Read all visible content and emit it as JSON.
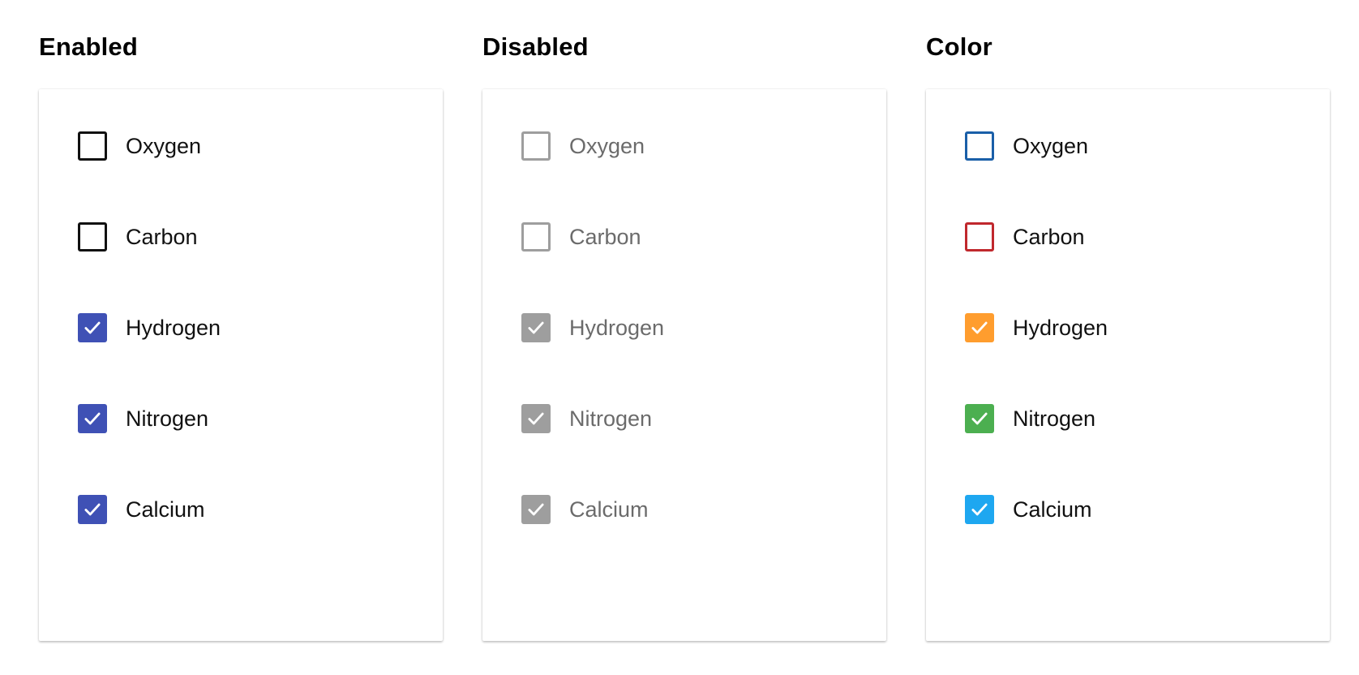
{
  "sections": [
    {
      "title": "Enabled",
      "disabled": false,
      "items": [
        {
          "label": "Oxygen",
          "checked": false,
          "color": "#111111"
        },
        {
          "label": "Carbon",
          "checked": false,
          "color": "#111111"
        },
        {
          "label": "Hydrogen",
          "checked": true,
          "color": "#3f51b5"
        },
        {
          "label": "Nitrogen",
          "checked": true,
          "color": "#3f51b5"
        },
        {
          "label": "Calcium",
          "checked": true,
          "color": "#3f51b5"
        }
      ]
    },
    {
      "title": "Disabled",
      "disabled": true,
      "items": [
        {
          "label": "Oxygen",
          "checked": false,
          "color": "#9e9e9e"
        },
        {
          "label": "Carbon",
          "checked": false,
          "color": "#9e9e9e"
        },
        {
          "label": "Hydrogen",
          "checked": true,
          "color": "#9e9e9e"
        },
        {
          "label": "Nitrogen",
          "checked": true,
          "color": "#9e9e9e"
        },
        {
          "label": "Calcium",
          "checked": true,
          "color": "#9e9e9e"
        }
      ]
    },
    {
      "title": "Color",
      "disabled": false,
      "items": [
        {
          "label": "Oxygen",
          "checked": false,
          "color": "#1a5fa8"
        },
        {
          "label": "Carbon",
          "checked": false,
          "color": "#c0282d"
        },
        {
          "label": "Hydrogen",
          "checked": true,
          "color": "#ff9d2e"
        },
        {
          "label": "Nitrogen",
          "checked": true,
          "color": "#4caf50"
        },
        {
          "label": "Calcium",
          "checked": true,
          "color": "#1ea7f0"
        }
      ]
    }
  ]
}
